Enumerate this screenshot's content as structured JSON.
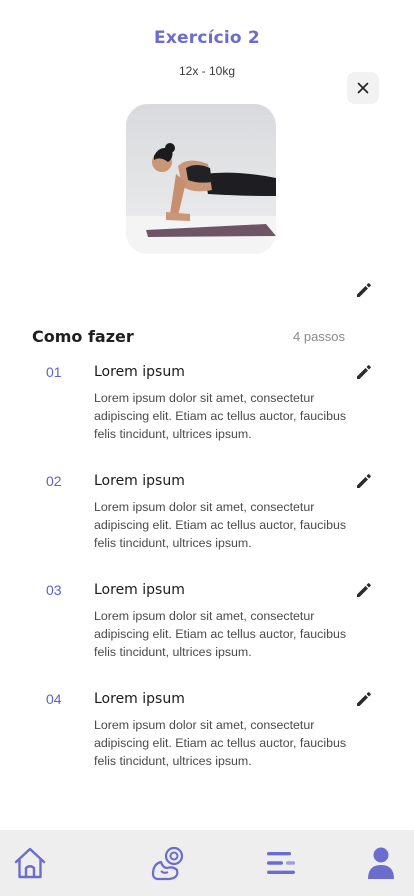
{
  "header": {
    "title": "Exercício  2",
    "subtitle": "12x - 10kg"
  },
  "icons": {
    "close": "close-icon",
    "edit": "pencil-icon",
    "home": "home-icon",
    "workout": "workout-icon",
    "menu": "menu-icon",
    "profile": "profile-icon"
  },
  "colors": {
    "accent": "#6a6dcd",
    "step_number": "#5b63c9",
    "tab_bar": "#efeeee"
  },
  "how_to": {
    "title": "Como fazer",
    "count": "4 passos",
    "steps": [
      {
        "number": "01",
        "title": "Lorem ipsum",
        "description": "Lorem ipsum dolor sit amet, consectetur adipiscing elit. Etiam ac tellus auctor, faucibus felis tincidunt, ultrices ipsum."
      },
      {
        "number": "02",
        "title": "Lorem ipsum",
        "description": "Lorem ipsum dolor sit amet, consectetur adipiscing elit. Etiam ac tellus auctor, faucibus felis tincidunt, ultrices ipsum."
      },
      {
        "number": "03",
        "title": "Lorem ipsum",
        "description": "Lorem ipsum dolor sit amet, consectetur adipiscing elit. Etiam ac tellus auctor, faucibus felis tincidunt, ultrices ipsum."
      },
      {
        "number": "04",
        "title": "Lorem ipsum",
        "description": "Lorem ipsum dolor sit amet, consectetur adipiscing elit. Etiam ac tellus auctor, faucibus felis tincidunt, ultrices ipsum."
      }
    ]
  }
}
